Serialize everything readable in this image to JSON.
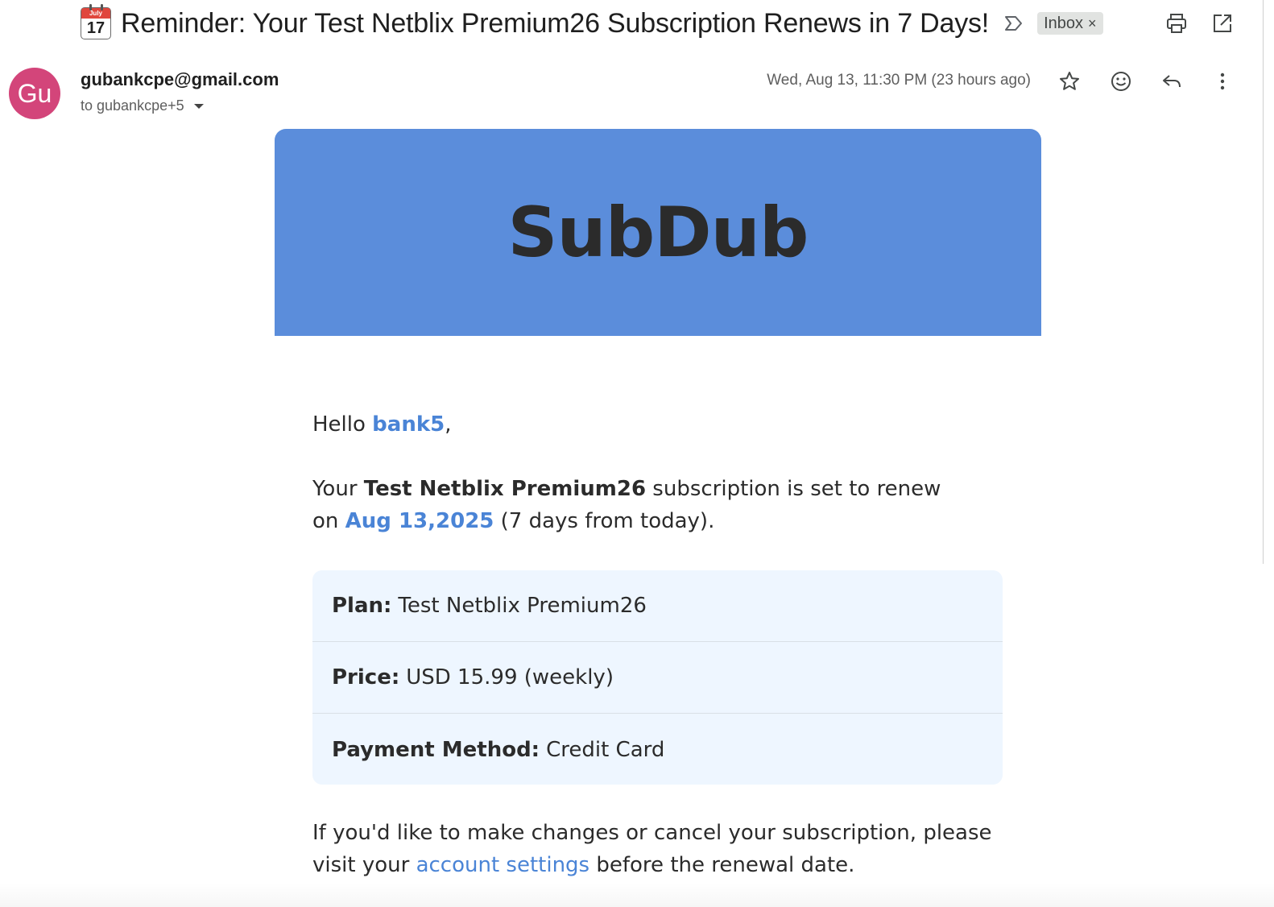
{
  "email": {
    "subject": "Reminder: Your Test Netblix Premium26 Subscription Renews in 7 Days!",
    "calendar_icon": {
      "month": "July",
      "day": "17"
    },
    "label_chip": "Inbox",
    "label_chip_close": "×",
    "sender_initials": "Gu",
    "sender_email": "gubankcpe@gmail.com",
    "recipients": "to gubankcpe+5",
    "timestamp": "Wed, Aug 13, 11:30 PM (23 hours ago)",
    "icons": {
      "importance": "importance-marker-icon",
      "print": "print-icon",
      "open_new_window": "open-in-new-window-icon",
      "star": "star-icon",
      "emoji": "emoji-reaction-icon",
      "reply": "reply-icon",
      "more": "more-vert-icon"
    },
    "colors": {
      "avatar": "#d3457a",
      "banner": "#5b8ddb",
      "highlight": "#4a84d6",
      "details_bg": "#eef6ff"
    }
  },
  "message": {
    "brand": "SubDub",
    "greeting_prefix": "Hello ",
    "user_name": "bank5",
    "greeting_suffix": ",",
    "renew_line": {
      "p1": "Your ",
      "plan_name": "Test Netblix Premium26",
      "p2": " subscription is set to renew on ",
      "date": "Aug 13,2025",
      "p3": " (7 days from today)."
    },
    "details": [
      {
        "label": "Plan:",
        "value": "Test Netblix Premium26"
      },
      {
        "label": "Price:",
        "value": "USD 15.99 (weekly)"
      },
      {
        "label": "Payment Method:",
        "value": "Credit Card"
      }
    ],
    "footer": {
      "p1": "If you'd like to make changes or cancel your subscription, please visit your ",
      "link": "account settings",
      "p2": " before the renewal date."
    }
  }
}
